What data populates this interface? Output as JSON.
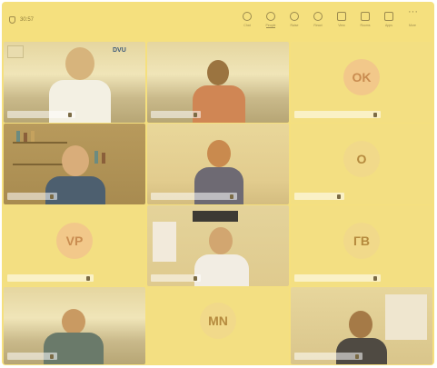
{
  "topbar": {
    "timer_text": "30:57",
    "tools": [
      {
        "name": "chat-tool",
        "label": "Chat"
      },
      {
        "name": "people-tool",
        "label": "People"
      },
      {
        "name": "raise-tool",
        "label": "Raise"
      },
      {
        "name": "react-tool",
        "label": "React"
      },
      {
        "name": "view-tool",
        "label": "View"
      },
      {
        "name": "rooms-tool",
        "label": "Rooms"
      },
      {
        "name": "apps-tool",
        "label": "Apps"
      },
      {
        "name": "more-tool",
        "label": "More"
      }
    ]
  },
  "tiles": [
    {
      "kind": "video",
      "scene": "logo"
    },
    {
      "kind": "video",
      "scene": "mountains-man"
    },
    {
      "kind": "avatar",
      "initials": "OK"
    },
    {
      "kind": "video",
      "scene": "books"
    },
    {
      "kind": "video",
      "scene": "office-woman"
    },
    {
      "kind": "avatar",
      "initials": "O"
    },
    {
      "kind": "avatar",
      "initials": "VP"
    },
    {
      "kind": "video",
      "scene": "room-man"
    },
    {
      "kind": "avatar",
      "initials": "ГВ"
    },
    {
      "kind": "video",
      "scene": "mountains-man2"
    },
    {
      "kind": "avatar",
      "initials": "MN"
    },
    {
      "kind": "video",
      "scene": "headset-man"
    }
  ],
  "logo": {
    "text": "DVU"
  },
  "colors": {
    "overlay": "#f5e07e",
    "avatar_text": "#b98d3c"
  }
}
